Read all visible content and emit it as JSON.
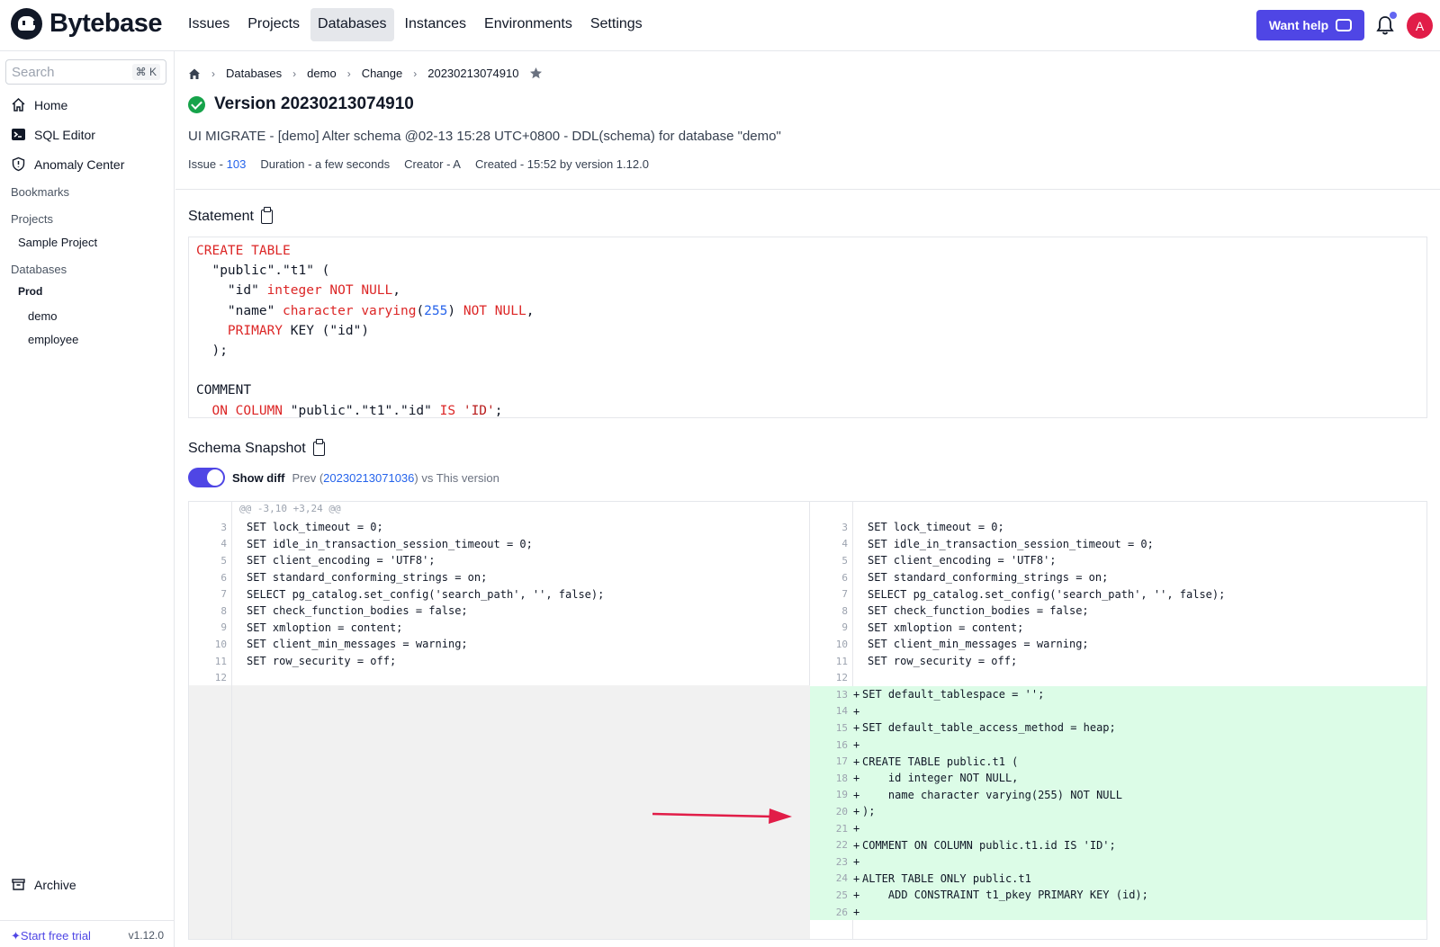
{
  "app": {
    "name": "Bytebase"
  },
  "nav": {
    "items": [
      "Issues",
      "Projects",
      "Databases",
      "Instances",
      "Environments",
      "Settings"
    ],
    "active": "Databases"
  },
  "header": {
    "help_label": "Want help",
    "avatar_letter": "A"
  },
  "sidebar": {
    "search_placeholder": "Search",
    "search_shortcut": "⌘ K",
    "home": "Home",
    "sql_editor": "SQL Editor",
    "anomaly_center": "Anomaly Center",
    "bookmarks": "Bookmarks",
    "projects_label": "Projects",
    "sample_project": "Sample Project",
    "databases_label": "Databases",
    "env_prod": "Prod",
    "db_demo": "demo",
    "db_employee": "employee",
    "archive": "Archive",
    "trial": "Start free trial",
    "version": "v1.12.0"
  },
  "breadcrumb": {
    "databases": "Databases",
    "demo": "demo",
    "change": "Change",
    "version": "20230213074910"
  },
  "page": {
    "title": "Version 20230213074910",
    "subtitle": "UI MIGRATE - [demo] Alter schema @02-13 15:28 UTC+0800 - DDL(schema) for database \"demo\"",
    "issue_label": "Issue - ",
    "issue_number": "103",
    "duration": "Duration - a few seconds",
    "creator": "Creator - A",
    "created": "Created - 15:52 by version 1.12.0"
  },
  "statement": {
    "title": "Statement",
    "l1_kw": "CREATE TABLE",
    "l2": "  \"public\".\"t1\" (",
    "l3_a": "    \"id\" ",
    "l3_kw": "integer NOT NULL",
    "l3_b": ",",
    "l4_a": "    \"name\" ",
    "l4_kw": "character varying",
    "l4_b": "(",
    "l4_num": "255",
    "l4_c": ") ",
    "l4_kw2": "NOT NULL",
    "l4_d": ",",
    "l5_kw": "    PRIMARY",
    "l5_b": " KEY (\"id\")",
    "l6": "  );",
    "l8": "COMMENT",
    "l9_kw": "  ON COLUMN",
    "l9_b": " \"public\".\"t1\".\"id\" ",
    "l9_kw2": "IS",
    "l9_c": " ",
    "l9_str": "'ID'",
    "l9_d": ";"
  },
  "snapshot": {
    "title": "Schema Snapshot",
    "show_diff": "Show diff",
    "prev_label": "Prev (",
    "prev_version": "20230213071036",
    "prev_suffix": ") vs This version",
    "hunk": "@@ -3,10 +3,24 @@",
    "common_lines": [
      {
        "n": "3",
        "t": "SET lock_timeout = 0;"
      },
      {
        "n": "4",
        "t": "SET idle_in_transaction_session_timeout = 0;"
      },
      {
        "n": "5",
        "t": "SET client_encoding = 'UTF8';"
      },
      {
        "n": "6",
        "t": "SET standard_conforming_strings = on;"
      },
      {
        "n": "7",
        "t": "SELECT pg_catalog.set_config('search_path', '', false);"
      },
      {
        "n": "8",
        "t": "SET check_function_bodies = false;"
      },
      {
        "n": "9",
        "t": "SET xmloption = content;"
      },
      {
        "n": "10",
        "t": "SET client_min_messages = warning;"
      },
      {
        "n": "11",
        "t": "SET row_security = off;"
      },
      {
        "n": "12",
        "t": ""
      }
    ],
    "added_lines": [
      {
        "n": "13",
        "t": "SET default_tablespace = '';"
      },
      {
        "n": "14",
        "t": ""
      },
      {
        "n": "15",
        "t": "SET default_table_access_method = heap;"
      },
      {
        "n": "16",
        "t": ""
      },
      {
        "n": "17",
        "t": "CREATE TABLE public.t1 ("
      },
      {
        "n": "18",
        "t": "    id integer NOT NULL,"
      },
      {
        "n": "19",
        "t": "    name character varying(255) NOT NULL"
      },
      {
        "n": "20",
        "t": ");"
      },
      {
        "n": "21",
        "t": ""
      },
      {
        "n": "22",
        "t": "COMMENT ON COLUMN public.t1.id IS 'ID';"
      },
      {
        "n": "23",
        "t": ""
      },
      {
        "n": "24",
        "t": "ALTER TABLE ONLY public.t1"
      },
      {
        "n": "25",
        "t": "    ADD CONSTRAINT t1_pkey PRIMARY KEY (id);"
      },
      {
        "n": "26",
        "t": ""
      }
    ]
  },
  "colors": {
    "accent": "#4f46e5",
    "success": "#16a34a",
    "diff_added": "#dcfce7",
    "annotation_arrow": "#e11d48"
  }
}
